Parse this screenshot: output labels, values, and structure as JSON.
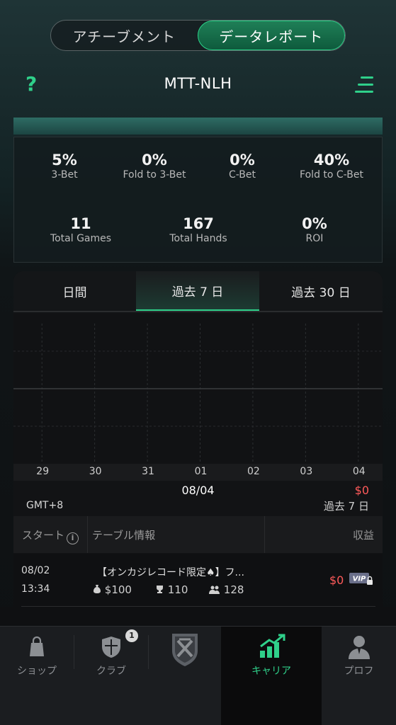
{
  "top_tabs": [
    {
      "label": "アチーブメント",
      "active": false
    },
    {
      "label": "データレポート",
      "active": true
    }
  ],
  "header": {
    "help_icon": "?",
    "title": "MTT-NLH",
    "menu_icon": "menu-icon"
  },
  "stats": [
    {
      "value": "5%",
      "label": "3-Bet"
    },
    {
      "value": "0%",
      "label": "Fold to 3-Bet"
    },
    {
      "value": "0%",
      "label": "C-Bet"
    },
    {
      "value": "40%",
      "label": "Fold to C-Bet"
    },
    {
      "value": "11",
      "label": "Total Games"
    },
    {
      "value": "167",
      "label": "Total Hands"
    },
    {
      "value": "0%",
      "label": "ROI"
    }
  ],
  "range_tabs": [
    {
      "label": "日間",
      "active": false
    },
    {
      "label": "過去 7 日",
      "active": true
    },
    {
      "label": "過去 30 日",
      "active": false
    }
  ],
  "chart_data": {
    "type": "line",
    "categories": [
      "29",
      "30",
      "31",
      "01",
      "02",
      "03",
      "04"
    ],
    "series": [],
    "grid": true
  },
  "summary": {
    "selected_date": "08/04",
    "selected_value": "$0",
    "timezone": "GMT+8",
    "period": "過去 7 日"
  },
  "table": {
    "headers": {
      "start": "スタート",
      "info_icon": "i",
      "table_info": "テーブル情報",
      "profit": "収益"
    },
    "rows": [
      {
        "date": "08/02",
        "time": "13:34",
        "name": "【オンカジレコード限定♠】フ...",
        "buy_in": "$100",
        "place": "110",
        "players": "128",
        "profit": "$0",
        "vip": "VIP"
      }
    ]
  },
  "bottom_nav": [
    {
      "label": "ショップ",
      "icon": "shop-bag-icon",
      "active": false
    },
    {
      "label": "クラブ",
      "icon": "club-shield-icon",
      "active": false,
      "badge": "1"
    },
    {
      "label": "",
      "icon": "home-logo-icon",
      "active": false
    },
    {
      "label": "キャリア",
      "icon": "career-chart-icon",
      "active": true
    },
    {
      "label": "プロフ",
      "icon": "profile-icon",
      "active": false
    }
  ],
  "colors": {
    "accent": "#2fd08a",
    "negative": "#ff5a5a",
    "background": "#0e1012"
  }
}
